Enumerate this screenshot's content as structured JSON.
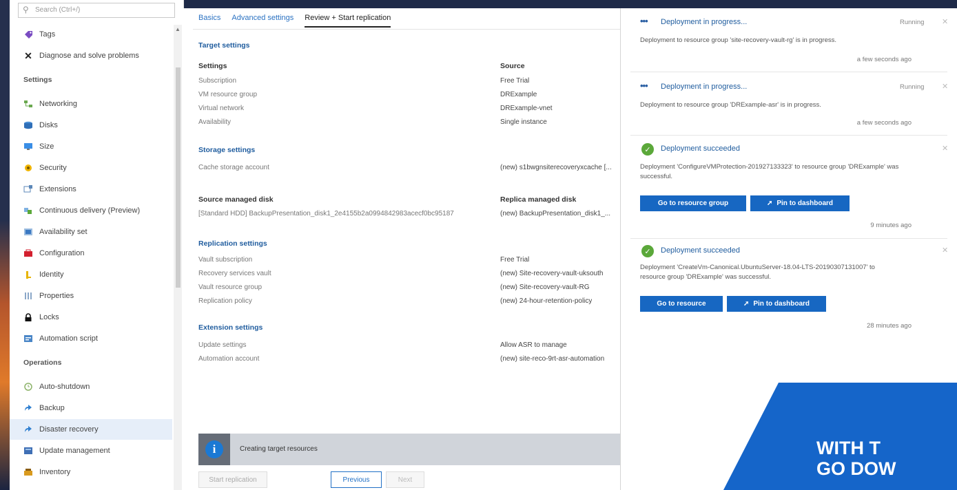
{
  "sidebar": {
    "search_placeholder": "Search (Ctrl+/)",
    "items_top": [
      {
        "label": "Tags",
        "icon": "tag-icon"
      },
      {
        "label": "Diagnose and solve problems",
        "icon": "wrench-icon"
      }
    ],
    "settings_header": "Settings",
    "settings_items": [
      {
        "label": "Networking",
        "icon": "networking-icon"
      },
      {
        "label": "Disks",
        "icon": "disks-icon"
      },
      {
        "label": "Size",
        "icon": "size-icon"
      },
      {
        "label": "Security",
        "icon": "security-icon"
      },
      {
        "label": "Extensions",
        "icon": "extensions-icon"
      },
      {
        "label": "Continuous delivery (Preview)",
        "icon": "continuous-delivery-icon"
      },
      {
        "label": "Availability set",
        "icon": "availability-set-icon"
      },
      {
        "label": "Configuration",
        "icon": "configuration-icon"
      },
      {
        "label": "Identity",
        "icon": "identity-icon"
      },
      {
        "label": "Properties",
        "icon": "properties-icon"
      },
      {
        "label": "Locks",
        "icon": "lock-icon"
      },
      {
        "label": "Automation script",
        "icon": "automation-script-icon"
      }
    ],
    "operations_header": "Operations",
    "operations_items": [
      {
        "label": "Auto-shutdown",
        "icon": "clock-icon"
      },
      {
        "label": "Backup",
        "icon": "backup-icon"
      },
      {
        "label": "Disaster recovery",
        "icon": "disaster-recovery-icon",
        "selected": true
      },
      {
        "label": "Update management",
        "icon": "update-management-icon"
      },
      {
        "label": "Inventory",
        "icon": "inventory-icon"
      }
    ]
  },
  "main": {
    "tabs": [
      {
        "label": "Basics",
        "active": false
      },
      {
        "label": "Advanced settings",
        "active": false
      },
      {
        "label": "Review + Start replication",
        "active": true
      }
    ],
    "target_settings": {
      "title": "Target settings",
      "settings_header": "Settings",
      "source_header": "Source",
      "rows": [
        {
          "label": "Subscription",
          "value": "Free Trial"
        },
        {
          "label": "VM resource group",
          "value": "DRExample"
        },
        {
          "label": "Virtual network",
          "value": "DRExample-vnet"
        },
        {
          "label": "Availability",
          "value": "Single instance"
        }
      ]
    },
    "storage_settings": {
      "title": "Storage settings",
      "rows": [
        {
          "label": "Cache storage account",
          "value": "(new) s1bwgnsiterecoveryxcache [..."
        }
      ]
    },
    "disks": {
      "source_header": "Source managed disk",
      "replica_header": "Replica managed disk",
      "source_value": "[Standard HDD] BackupPresentation_disk1_2e4155b2a0994842983acecf0bc95187",
      "replica_value": "(new) BackupPresentation_disk1_..."
    },
    "replication_settings": {
      "title": "Replication settings",
      "rows": [
        {
          "label": "Vault subscription",
          "value": "Free Trial"
        },
        {
          "label": "Recovery services vault",
          "value": "(new) Site-recovery-vault-uksouth"
        },
        {
          "label": "Vault resource group",
          "value": "(new) Site-recovery-vault-RG"
        },
        {
          "label": "Replication policy",
          "value": "(new) 24-hour-retention-policy"
        }
      ]
    },
    "extension_settings": {
      "title": "Extension settings",
      "rows": [
        {
          "label": "Update settings",
          "value": "Allow ASR to manage"
        },
        {
          "label": "Automation account",
          "value": "(new) site-reco-9rt-asr-automation"
        }
      ]
    },
    "status": {
      "icon_glyph": "i",
      "text": "Creating target resources"
    },
    "footer": {
      "start_label": "Start replication",
      "previous_label": "Previous",
      "next_label": "Next"
    }
  },
  "notifications": [
    {
      "kind": "progress",
      "title": "Deployment in progress...",
      "status": "Running",
      "body": "Deployment to resource group 'site-recovery-vault-rg' is in progress.",
      "time": "a few seconds ago"
    },
    {
      "kind": "progress",
      "title": "Deployment in progress...",
      "status": "Running",
      "body": "Deployment to resource group 'DRExample-asr' is in progress.",
      "time": "a few seconds ago"
    },
    {
      "kind": "success",
      "title": "Deployment succeeded",
      "body": "Deployment 'ConfigureVMProtection-201927133323' to resource group 'DRExample' was successful.",
      "btn1": "Go to resource group",
      "btn2": "Pin to dashboard",
      "time": "9 minutes ago"
    },
    {
      "kind": "success",
      "title": "Deployment succeeded",
      "body": "Deployment 'CreateVm-Canonical.UbuntuServer-18.04-LTS-20190307131007' to resource group 'DRExample' was successful.",
      "btn1": "Go to resource",
      "btn2": "Pin to dashboard",
      "time": "28 minutes ago"
    }
  ],
  "banner": {
    "line1": "WITH T",
    "line2": "GO DOW",
    "color": "#1565c9"
  },
  "colors": {
    "accent": "#1767c2",
    "link": "#1f5c9e",
    "success": "#5ba83a",
    "selected_row": "#e6eef9"
  }
}
